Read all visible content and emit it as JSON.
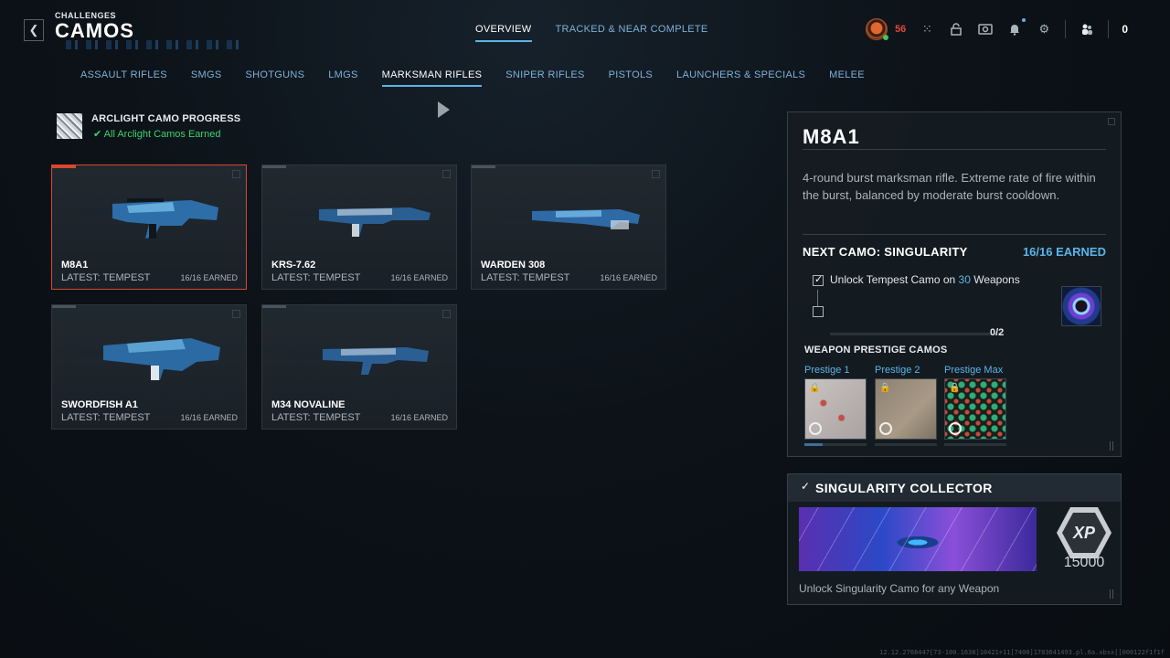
{
  "header": {
    "breadcrumb": "CHALLENGES",
    "title": "CAMOS",
    "back_icon": "chevron-left-icon",
    "tabs": [
      {
        "label": "OVERVIEW",
        "active": true
      },
      {
        "label": "TRACKED & NEAR COMPLETE",
        "active": false
      }
    ]
  },
  "hud": {
    "level": "56",
    "friends_count": "0",
    "icons": [
      "grid-icon",
      "lock-icon",
      "store-icon",
      "bell-icon",
      "gear-icon",
      "friends-icon"
    ]
  },
  "categories": [
    {
      "label": "ASSAULT RIFLES",
      "active": false
    },
    {
      "label": "SMGS",
      "active": false
    },
    {
      "label": "SHOTGUNS",
      "active": false
    },
    {
      "label": "LMGS",
      "active": false
    },
    {
      "label": "MARKSMAN RIFLES",
      "active": true
    },
    {
      "label": "SNIPER RIFLES",
      "active": false
    },
    {
      "label": "PISTOLS",
      "active": false
    },
    {
      "label": "LAUNCHERS & SPECIALS",
      "active": false
    },
    {
      "label": "MELEE",
      "active": false
    }
  ],
  "arclight": {
    "title": "ARCLIGHT CAMO PROGRESS",
    "status": "✔ All Arclight Camos Earned"
  },
  "weapons": [
    {
      "name": "M8A1",
      "latest": "LATEST: TEMPEST",
      "earned": "16/16 EARNED",
      "selected": true
    },
    {
      "name": "KRS-7.62",
      "latest": "LATEST: TEMPEST",
      "earned": "16/16 EARNED",
      "selected": false
    },
    {
      "name": "WARDEN 308",
      "latest": "LATEST: TEMPEST",
      "earned": "16/16 EARNED",
      "selected": false
    },
    {
      "name": "SWORDFISH A1",
      "latest": "LATEST: TEMPEST",
      "earned": "16/16 EARNED",
      "selected": false
    },
    {
      "name": "M34 NOVALINE",
      "latest": "LATEST: TEMPEST",
      "earned": "16/16 EARNED",
      "selected": false
    }
  ],
  "detail": {
    "name": "M8A1",
    "description": "4-round burst marksman rifle. Extreme rate of fire within the burst, balanced by moderate burst cooldown.",
    "next_camo": "NEXT CAMO: SINGULARITY",
    "next_earned": "16/16 EARNED",
    "task_prefix": "Unlock Tempest Camo on ",
    "task_count": "30",
    "task_suffix": " Weapons",
    "progress_label": "0/2",
    "progress_fraction": 0,
    "prestige_title": "WEAPON PRESTIGE CAMOS",
    "prestige": [
      {
        "label": "Prestige 1",
        "progress": 0.3
      },
      {
        "label": "Prestige 2",
        "progress": 0
      },
      {
        "label": "Prestige Max",
        "progress": 0
      }
    ]
  },
  "reward": {
    "title": "SINGULARITY COLLECTOR",
    "xp_label": "XP",
    "xp_amount": "15000",
    "description": "Unlock Singularity Camo for any Weapon"
  },
  "build_string": "12.12.2768447[73-100.1638]10421+11[7400]1783641493.pl.6a.xbsx[[000122f1f1f"
}
